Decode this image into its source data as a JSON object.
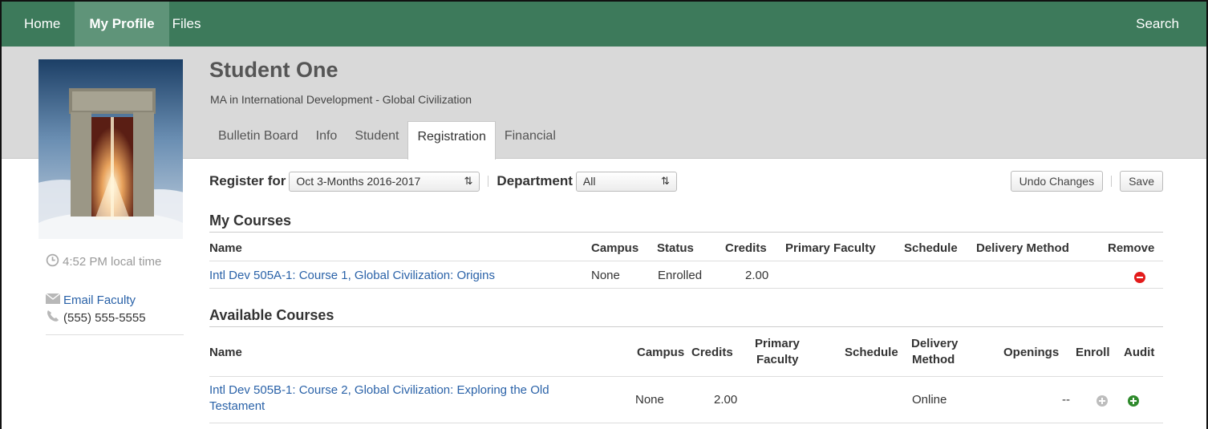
{
  "nav": {
    "items": [
      {
        "label": "Home"
      },
      {
        "label": "My Profile"
      },
      {
        "label": "Files"
      }
    ],
    "search_label": "Search"
  },
  "profile": {
    "name": "Student One",
    "program": "MA in International Development - Global Civilization",
    "local_time": "4:52 PM local time",
    "email_label": "Email Faculty",
    "phone": "(555) 555-5555"
  },
  "tabs": [
    {
      "label": "Bulletin Board"
    },
    {
      "label": "Info"
    },
    {
      "label": "Student"
    },
    {
      "label": "Registration"
    },
    {
      "label": "Financial"
    }
  ],
  "register": {
    "register_for_label": "Register for",
    "register_for_value": "Oct 3-Months 2016-2017",
    "department_label": "Department",
    "department_value": "All",
    "undo_label": "Undo Changes",
    "save_label": "Save"
  },
  "my_courses": {
    "title": "My Courses",
    "headers": {
      "name": "Name",
      "campus": "Campus",
      "status": "Status",
      "credits": "Credits",
      "faculty": "Primary Faculty",
      "schedule": "Schedule",
      "delivery": "Delivery Method",
      "remove": "Remove"
    },
    "rows": [
      {
        "name": "Intl Dev 505A-1: Course 1, Global Civilization: Origins",
        "campus": "None",
        "status": "Enrolled",
        "credits": "2.00"
      }
    ]
  },
  "available_courses": {
    "title": "Available Courses",
    "headers": {
      "name": "Name",
      "campus": "Campus",
      "credits": "Credits",
      "faculty_1": "Primary",
      "faculty_2": "Faculty",
      "schedule": "Schedule",
      "delivery_1": "Delivery",
      "delivery_2": "Method",
      "openings": "Openings",
      "enroll": "Enroll",
      "audit": "Audit"
    },
    "rows": [
      {
        "name_1": "Intl Dev 505B-1: Course 2, Global Civilization: Exploring the Old",
        "name_2": "Testament",
        "campus": "None",
        "credits": "2.00",
        "delivery": "Online",
        "openings": "--"
      }
    ]
  },
  "colors": {
    "nav_bg": "#3d7a5b",
    "nav_active": "#5f9479",
    "link": "#2a62a8",
    "remove": "#e31b1b",
    "audit": "#2f8a2c"
  }
}
